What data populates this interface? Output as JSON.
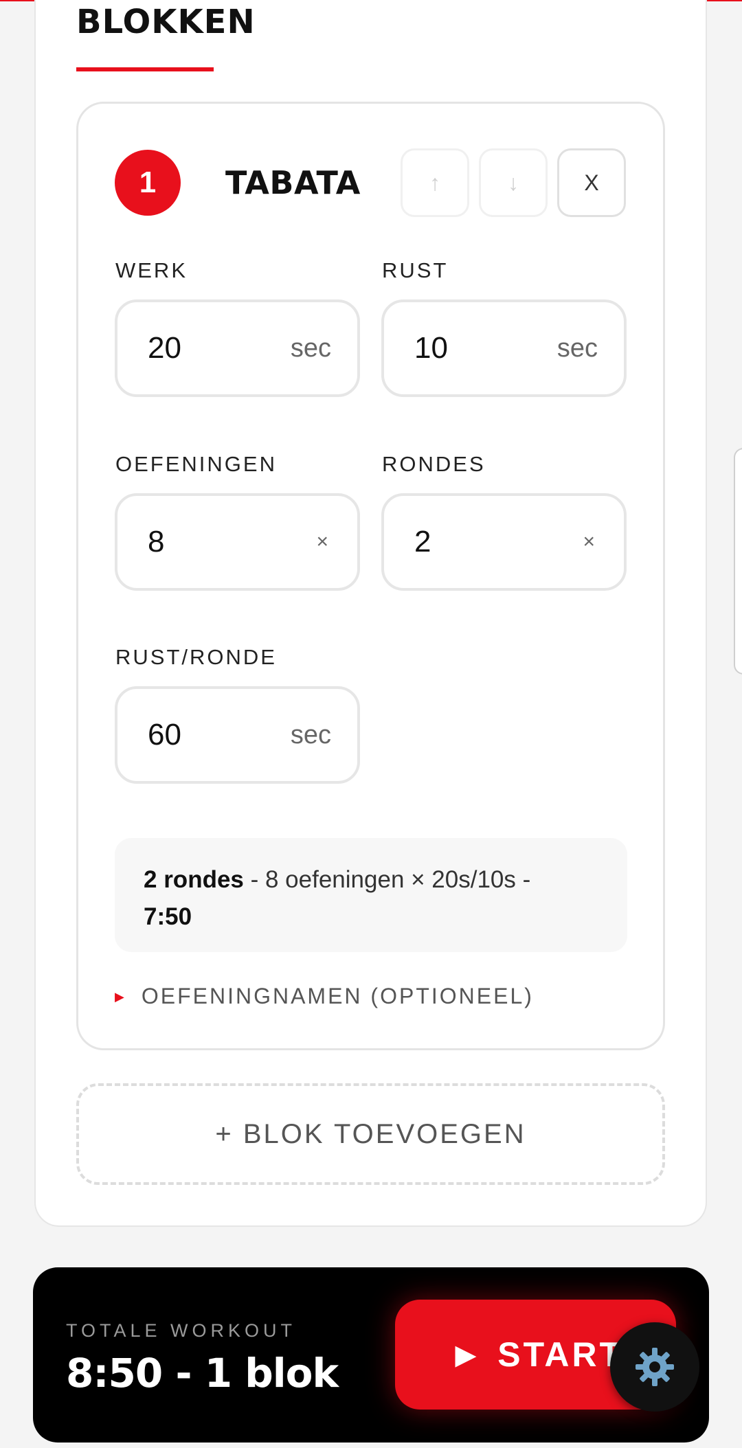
{
  "section": {
    "title": "BLOKKEN"
  },
  "block": {
    "number": "1",
    "name": "TABATA",
    "controls": {
      "up": "↑",
      "down": "↓",
      "remove": "X"
    },
    "fields": {
      "work": {
        "label": "WERK",
        "value": "20",
        "unit": "sec"
      },
      "rest": {
        "label": "RUST",
        "value": "10",
        "unit": "sec"
      },
      "exercises": {
        "label": "OEFENINGEN",
        "value": "8",
        "unit": "×"
      },
      "rounds": {
        "label": "RONDES",
        "value": "2",
        "unit": "×"
      },
      "rest_per_round": {
        "label": "RUST/RONDE",
        "value": "60",
        "unit": "sec"
      }
    },
    "summary": {
      "rounds": "2 rondes",
      "detail": " - 8 oefeningen × 20s/10s - ",
      "duration": "7:50"
    },
    "exercise_names_toggle": "OEFENINGNAMEN (OPTIONEEL)"
  },
  "add_block_label": "+ BLOK TOEVOEGEN",
  "footer": {
    "total_label": "TOTALE WORKOUT",
    "total_value": "8:50 - 1 blok",
    "start_label": "START"
  },
  "colors": {
    "accent": "#e8101c",
    "bar": "#000000"
  }
}
